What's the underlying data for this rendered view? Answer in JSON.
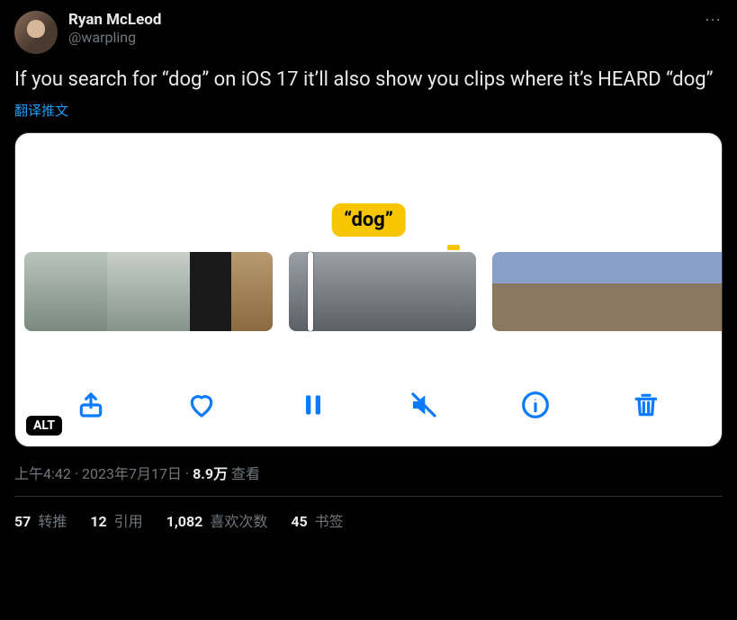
{
  "author": {
    "display_name": "Ryan McLeod",
    "handle": "@warpling"
  },
  "more_glyph": "⋯",
  "body": "If you search for “dog” on iOS 17 it’ll also show you clips where it’s HEARD “dog”",
  "translate_label": "翻译推文",
  "media": {
    "caption": "“dog”",
    "alt_badge": "ALT"
  },
  "meta": {
    "time": "上午4:42",
    "sep": " · ",
    "date": "2023年7月17日",
    "views_count": "8.9万",
    "views_label": " 查看"
  },
  "stats": {
    "retweets": {
      "num": "57",
      "label": " 转推"
    },
    "quotes": {
      "num": "12",
      "label": " 引用"
    },
    "likes": {
      "num": "1,082",
      "label": " 喜欢次数"
    },
    "bookmarks": {
      "num": "45",
      "label": " 书签"
    }
  }
}
